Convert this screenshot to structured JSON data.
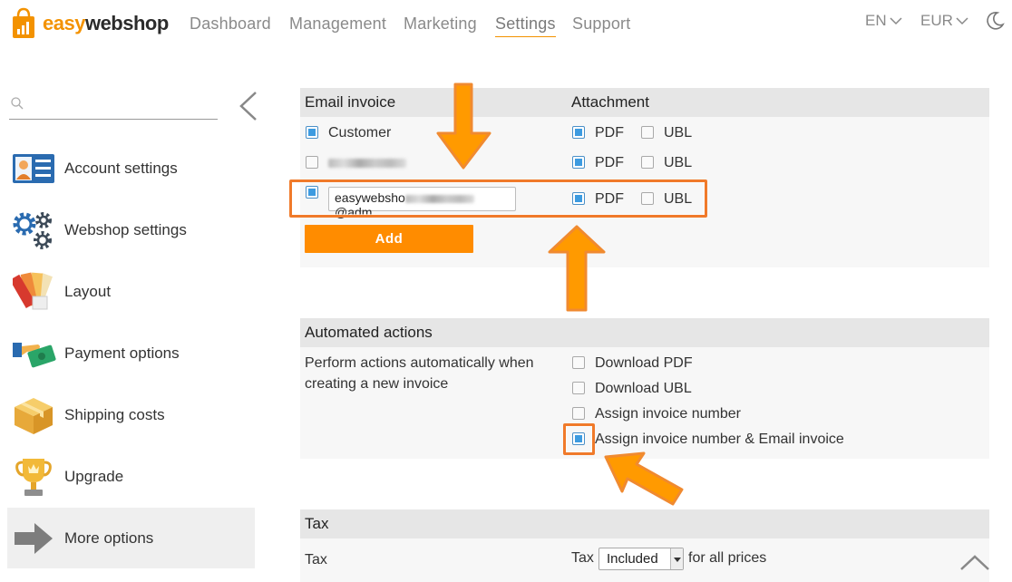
{
  "brand": {
    "part1": "easy",
    "part2": "webshop"
  },
  "nav": {
    "items": [
      {
        "label": "Dashboard",
        "active": false
      },
      {
        "label": "Management",
        "active": false
      },
      {
        "label": "Marketing",
        "active": false
      },
      {
        "label": "Settings",
        "active": true
      },
      {
        "label": "Support",
        "active": false
      }
    ],
    "language": "EN",
    "currency": "EUR",
    "theme_icon": "moon-icon"
  },
  "sidebar": {
    "search_placeholder": "",
    "items": [
      {
        "label": "Account settings",
        "icon": "account-card-icon"
      },
      {
        "label": "Webshop settings",
        "icon": "gears-icon"
      },
      {
        "label": "Layout",
        "icon": "color-swatches-icon"
      },
      {
        "label": "Payment options",
        "icon": "payment-hand-icon"
      },
      {
        "label": "Shipping costs",
        "icon": "package-box-icon"
      },
      {
        "label": "Upgrade",
        "icon": "trophy-icon"
      },
      {
        "label": "More options",
        "icon": "arrow-right-icon",
        "active": true
      }
    ]
  },
  "email_invoice": {
    "header_left": "Email invoice",
    "header_right": "Attachment",
    "rows": [
      {
        "recipient": "Customer",
        "checked": true,
        "pdf": true,
        "ubl": false
      },
      {
        "recipient": "",
        "checked": false,
        "pdf": true,
        "ubl": false
      },
      {
        "recipient": "easywebsho",
        "recipient_suffix": "@adm",
        "checked": true,
        "pdf": true,
        "ubl": false
      }
    ],
    "pdf_label": "PDF",
    "ubl_label": "UBL",
    "add_label": "Add"
  },
  "automated_actions": {
    "header": "Automated actions",
    "description_line1": "Perform actions automatically when",
    "description_line2": "creating a new invoice",
    "options": [
      {
        "label": "Download PDF",
        "checked": false
      },
      {
        "label": "Download UBL",
        "checked": false
      },
      {
        "label": "Assign invoice number",
        "checked": false
      },
      {
        "label": "Assign invoice number & Email invoice",
        "checked": true
      }
    ]
  },
  "tax": {
    "header": "Tax",
    "row_label": "Tax",
    "prefix": "Tax",
    "selected": "Included",
    "suffix": "for all prices"
  },
  "colors": {
    "accent": "#f39200",
    "button": "#ff8c00",
    "highlight": "#f07a2a",
    "checkbox_fill": "#3d9be0"
  }
}
